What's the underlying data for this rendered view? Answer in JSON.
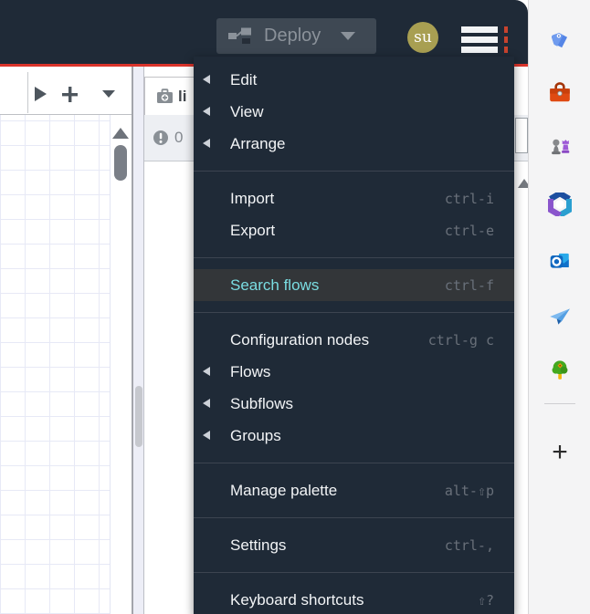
{
  "colors": {
    "header_bg": "#1f2a37",
    "accent_red": "#da342b",
    "menu_highlight_bg": "#333639",
    "menu_highlight_text": "#7adde2",
    "avatar_bg": "#a89f52"
  },
  "header": {
    "deploy_label": "Deploy",
    "avatar_text": "su"
  },
  "menu": {
    "items": [
      {
        "label": "Edit",
        "has_submenu": true
      },
      {
        "label": "View",
        "has_submenu": true
      },
      {
        "label": "Arrange",
        "has_submenu": true
      },
      {
        "label": "Import",
        "shortcut": "ctrl-i"
      },
      {
        "label": "Export",
        "shortcut": "ctrl-e"
      },
      {
        "label": "Search flows",
        "shortcut": "ctrl-f",
        "highlighted": true
      },
      {
        "label": "Configuration nodes",
        "shortcut": "ctrl-g c"
      },
      {
        "label": "Flows",
        "has_submenu": true
      },
      {
        "label": "Subflows",
        "has_submenu": true
      },
      {
        "label": "Groups",
        "has_submenu": true
      },
      {
        "label": "Manage palette",
        "shortcut": "alt-⇧p"
      },
      {
        "label": "Settings",
        "shortcut": "ctrl-,"
      },
      {
        "label": "Keyboard shortcuts",
        "shortcut": "⇧?"
      }
    ]
  },
  "workspace": {
    "flow_tab_label": "li",
    "warning_count": "0"
  },
  "browser_sidebar": {
    "icons": [
      "tag-icon",
      "toolbox-icon",
      "chess-icon",
      "microsoft-365-icon",
      "outlook-icon",
      "paper-plane-icon",
      "tree-icon"
    ],
    "add_button_glyph": "+"
  }
}
